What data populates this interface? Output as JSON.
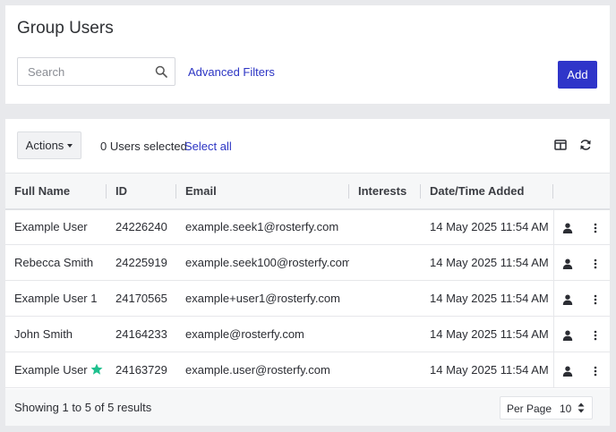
{
  "header": {
    "title": "Group Users",
    "search_placeholder": "Search",
    "search_value": "",
    "advanced_filters_label": "Advanced Filters",
    "add_label": "Add"
  },
  "toolbar": {
    "actions_label": "Actions",
    "selected_text": "0 Users selected",
    "select_all_label": "Select all",
    "icons": [
      "columns-icon",
      "refresh-icon"
    ]
  },
  "table": {
    "columns": [
      "Full Name",
      "ID",
      "Email",
      "Interests",
      "Date/Time Added"
    ],
    "rows": [
      {
        "name": "Example User",
        "id": "24226240",
        "email": "example.seek1@rosterfy.com",
        "interests": "",
        "added": "14 May 2025 11:54 AM",
        "starred": false
      },
      {
        "name": "Rebecca Smith",
        "id": "24225919",
        "email": "example.seek100@rosterfy.com",
        "interests": "",
        "added": "14 May 2025 11:54 AM",
        "starred": false
      },
      {
        "name": "Example User 1",
        "id": "24170565",
        "email": "example+user1@rosterfy.com",
        "interests": "",
        "added": "14 May 2025 11:54 AM",
        "starred": false
      },
      {
        "name": "John Smith",
        "id": "24164233",
        "email": "example@rosterfy.com",
        "interests": "",
        "added": "14 May 2025 11:54 AM",
        "starred": false
      },
      {
        "name": "Example User",
        "id": "24163729",
        "email": "example.user@rosterfy.com",
        "interests": "",
        "added": "14 May 2025 11:54 AM",
        "starred": true
      }
    ],
    "row_icons": [
      "user-icon",
      "more-vertical-icon"
    ]
  },
  "footer": {
    "results_text": "Showing 1 to 5 of 5 results",
    "per_page_label": "Per Page",
    "per_page_value": "10"
  },
  "colors": {
    "primary": "#2f35c9",
    "link": "#2c35c4",
    "star": "#1fc08e",
    "background": "#e8e9ec"
  }
}
